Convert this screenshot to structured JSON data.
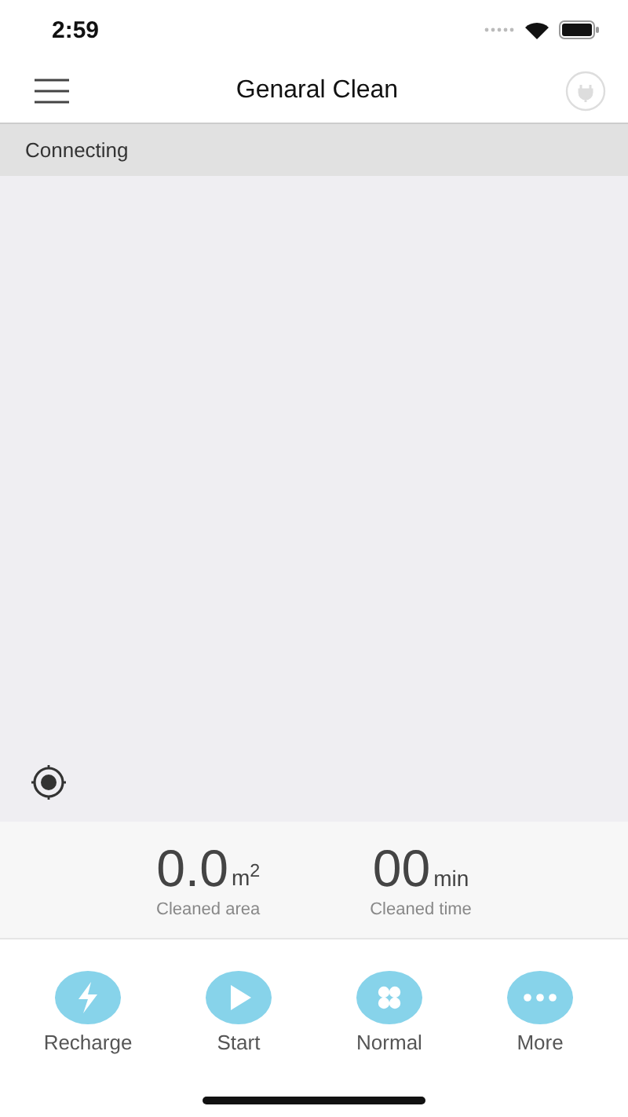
{
  "status_bar": {
    "time": "2:59"
  },
  "nav": {
    "title": "Genaral Clean"
  },
  "connection": {
    "status": "Connecting"
  },
  "stats": [
    {
      "value": "0.0",
      "unit": "m$^{2}$",
      "label": "Cleaned area"
    },
    {
      "value": "00",
      "unit": "min",
      "label": "Cleaned time"
    }
  ],
  "actions": [
    {
      "kind": "recharge",
      "label": "Recharge"
    },
    {
      "kind": "start",
      "label": "Start"
    },
    {
      "kind": "mode",
      "label": "Normal"
    },
    {
      "kind": "more",
      "label": "More"
    }
  ]
}
